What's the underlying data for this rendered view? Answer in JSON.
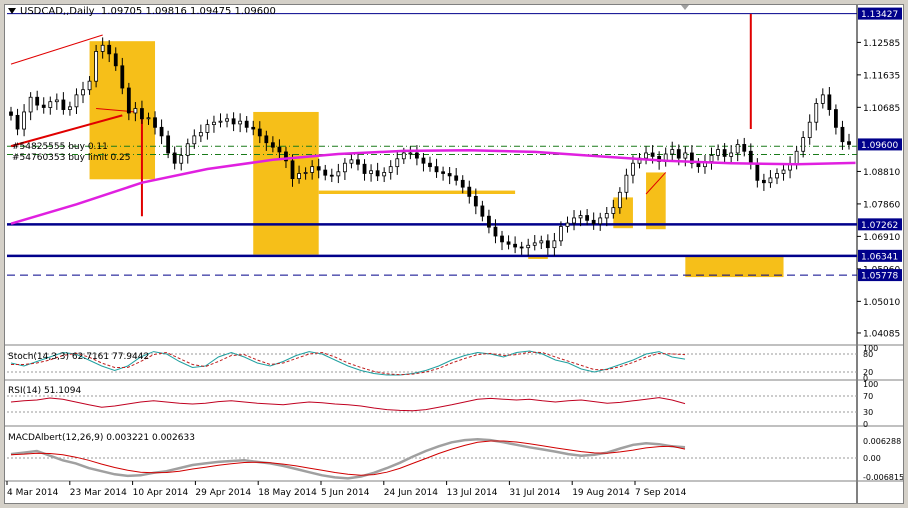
{
  "header": {
    "symbol": "USDCAD,,Daily",
    "ohlc": "1.09705 1.09816 1.09475 1.09600"
  },
  "orders": [
    "#54825555 buy 0.11",
    "#54760353 buy limit 0.25"
  ],
  "indicators": {
    "stoch": "Stoch(14,3,3) 62.7161 77.9442",
    "rsi": "RSI(14) 51.1094",
    "macd": "MACDAlbert(12,26,9) 0.003221 0.002633"
  },
  "colors": {
    "candle": "#000000",
    "ma": "#e020e0",
    "zone": "#f5b800",
    "blue_line": "#00008b",
    "red_line": "#e00000",
    "price_tag": "#00008b",
    "green_dash": "#1a7a1a"
  },
  "chart_data": {
    "type": "candlestick",
    "title": "USDCAD,,Daily",
    "y_ticks": [
      "1.12585",
      "1.11635",
      "1.10685",
      "1.08810",
      "1.07860",
      "1.06910",
      "1.05960",
      "1.05010",
      "1.04085"
    ],
    "y_tick_values": [
      1.12585,
      1.11635,
      1.10685,
      1.0881,
      1.0786,
      1.0691,
      1.0596,
      1.0501,
      1.04085
    ],
    "price_tags": [
      {
        "label": "1.13427",
        "value": 1.13427
      },
      {
        "label": "1.09600",
        "value": 1.096
      },
      {
        "label": "1.07262",
        "value": 1.07262
      },
      {
        "label": "1.06341",
        "value": 1.06341
      },
      {
        "label": "1.05778",
        "value": 1.05778
      }
    ],
    "x_labels": [
      "4 Mar 2014",
      "23 Mar 2014",
      "10 Apr 2014",
      "29 Apr 2014",
      "18 May 2014",
      "5 Jun 2014",
      "24 Jun 2014",
      "13 Jul 2014",
      "31 Jul 2014",
      "19 Aug 2014",
      "7 Sep 2014"
    ],
    "ylim": [
      1.0385,
      1.1362
    ],
    "closes": [
      1.1045,
      1.1005,
      1.1055,
      1.1098,
      1.1075,
      1.1068,
      1.1085,
      1.109,
      1.1062,
      1.107,
      1.1105,
      1.112,
      1.1145,
      1.1232,
      1.125,
      1.1225,
      1.119,
      1.1125,
      1.1052,
      1.1065,
      1.1035,
      1.1038,
      1.101,
      1.0985,
      1.0935,
      1.0905,
      1.0928,
      1.0962,
      1.0985,
      1.0995,
      1.1018,
      1.1025,
      1.1028,
      1.1035,
      1.102,
      1.1028,
      1.101,
      1.1005,
      1.0985,
      1.0965,
      1.0952,
      1.0938,
      1.0912,
      1.086,
      1.0875,
      1.0878,
      1.0895,
      1.0885,
      1.087,
      1.0868,
      1.088,
      1.0905,
      1.0915,
      1.0902,
      1.0875,
      1.0883,
      1.0868,
      1.0878,
      1.0895,
      1.0918,
      1.0935,
      1.0935,
      1.092,
      1.0905,
      1.0895,
      1.088,
      1.0875,
      1.0868,
      1.0855,
      1.0835,
      1.0808,
      1.078,
      1.075,
      1.0718,
      1.0692,
      1.0675,
      1.0668,
      1.066,
      1.0658,
      1.0665,
      1.0672,
      1.0678,
      1.0658,
      1.0678,
      1.072,
      1.073,
      1.0745,
      1.0752,
      1.0738,
      1.0728,
      1.0745,
      1.0758,
      1.0775,
      1.082,
      1.087,
      1.0905,
      1.092,
      1.0935,
      1.0925,
      1.091,
      1.0932,
      1.0945,
      1.092,
      1.0935,
      1.0905,
      1.0895,
      1.091,
      1.0928,
      1.0945,
      1.0925,
      1.0935,
      1.096,
      1.094,
      1.0905,
      1.0855,
      1.0848,
      1.0862,
      1.0875,
      1.0885,
      1.0902,
      1.094,
      1.098,
      1.1025,
      1.108,
      1.1105,
      1.1062,
      1.101,
      1.0968,
      1.096
    ],
    "ma": [
      [
        0,
        1.0728
      ],
      [
        10,
        1.0785
      ],
      [
        20,
        1.0848
      ],
      [
        30,
        1.0888
      ],
      [
        40,
        1.0915
      ],
      [
        50,
        1.0932
      ],
      [
        60,
        1.0941
      ],
      [
        70,
        1.0943
      ],
      [
        80,
        1.0938
      ],
      [
        90,
        1.0925
      ],
      [
        100,
        1.0912
      ],
      [
        110,
        1.0905
      ],
      [
        120,
        1.0902
      ],
      [
        129,
        1.0906
      ]
    ],
    "horizontal_lines": [
      {
        "value": 1.13427,
        "style": "solid",
        "color": "#00008b"
      },
      {
        "value": 1.09545,
        "style": "dashdot",
        "color": "#1a7a1a"
      },
      {
        "value": 1.09305,
        "style": "dashdot",
        "color": "#1a7a1a"
      },
      {
        "value": 1.07262,
        "style": "solid",
        "color": "#00008b"
      },
      {
        "value": 1.06341,
        "style": "solid",
        "color": "#00008b"
      },
      {
        "value": 1.05778,
        "style": "dashed",
        "color": "#00008b"
      }
    ],
    "zones": [
      {
        "i0": 12,
        "i1": 22,
        "v0": 1.1262,
        "v1": 1.0858
      },
      {
        "i0": 37,
        "i1": 47,
        "v0": 1.1055,
        "v1": 1.0638
      },
      {
        "i0": 103,
        "i1": 118,
        "v0": 1.0636,
        "v1": 1.0572
      },
      {
        "i0": 79,
        "i1": 82,
        "v0": 1.0635,
        "v1": 1.0625
      },
      {
        "i0": 47,
        "i1": 77,
        "v0": 1.0825,
        "v1": 1.0815
      },
      {
        "i0": 92,
        "i1": 95,
        "v0": 1.0805,
        "v1": 1.0715
      },
      {
        "i0": 97,
        "i1": 100,
        "v0": 1.0878,
        "v1": 1.0712
      }
    ],
    "stoch": {
      "label": "Stoch(14,3,3) 62.7161 77.9442",
      "ticks": [
        "100",
        "80",
        "20",
        "0"
      ],
      "main": [
        50,
        40,
        55,
        70,
        85,
        80,
        60,
        40,
        25,
        40,
        70,
        88,
        80,
        55,
        35,
        40,
        70,
        85,
        70,
        50,
        40,
        55,
        75,
        88,
        80,
        60,
        40,
        25,
        15,
        10,
        10,
        15,
        25,
        40,
        60,
        75,
        85,
        80,
        70,
        85,
        90,
        80,
        60,
        50,
        30,
        20,
        30,
        45,
        60,
        80,
        88,
        70,
        63
      ],
      "signal": [
        45,
        45,
        50,
        60,
        75,
        82,
        70,
        50,
        35,
        35,
        55,
        78,
        85,
        65,
        45,
        38,
        55,
        75,
        78,
        60,
        45,
        50,
        65,
        80,
        85,
        70,
        50,
        35,
        22,
        14,
        11,
        13,
        20,
        32,
        50,
        65,
        78,
        82,
        75,
        78,
        86,
        85,
        70,
        56,
        42,
        28,
        28,
        38,
        52,
        70,
        82,
        80,
        78
      ]
    },
    "rsi": {
      "label": "RSI(14) 51.1094",
      "ticks": [
        "100",
        "70",
        "30",
        "0"
      ],
      "values": [
        55,
        58,
        60,
        65,
        62,
        55,
        48,
        42,
        45,
        50,
        55,
        58,
        55,
        52,
        50,
        52,
        56,
        58,
        55,
        52,
        50,
        48,
        52,
        55,
        53,
        50,
        48,
        45,
        40,
        36,
        34,
        33,
        36,
        42,
        48,
        55,
        62,
        64,
        62,
        60,
        62,
        58,
        55,
        58,
        60,
        56,
        52,
        54,
        58,
        62,
        66,
        60,
        51
      ]
    },
    "macd": {
      "label": "MACDAlbert(12,26,9) 0.003221 0.002633",
      "ticks": [
        "0.006288",
        "0.00",
        "-0.006815"
      ],
      "main": [
        0.001,
        0.0015,
        0.002,
        0.0005,
        -0.001,
        -0.002,
        -0.0035,
        -0.0045,
        -0.0055,
        -0.006,
        -0.0058,
        -0.005,
        -0.0045,
        -0.0035,
        -0.0025,
        -0.002,
        -0.0015,
        -0.0012,
        -0.001,
        -0.0015,
        -0.002,
        -0.0028,
        -0.0038,
        -0.0048,
        -0.0058,
        -0.0065,
        -0.0068,
        -0.0062,
        -0.005,
        -0.0035,
        -0.0018,
        0.0002,
        0.002,
        0.0035,
        0.0048,
        0.0055,
        0.0058,
        0.0055,
        0.0048,
        0.004,
        0.0032,
        0.0025,
        0.0018,
        0.001,
        0.0005,
        0.0008,
        0.0015,
        0.0028,
        0.004,
        0.0045,
        0.0042,
        0.0035,
        0.0032
      ],
      "signal": [
        0.0008,
        0.001,
        0.0013,
        0.0012,
        0.0008,
        0.0,
        -0.001,
        -0.0022,
        -0.0033,
        -0.0042,
        -0.0048,
        -0.005,
        -0.0049,
        -0.0045,
        -0.0038,
        -0.0032,
        -0.0026,
        -0.0021,
        -0.0017,
        -0.0016,
        -0.0018,
        -0.0022,
        -0.0028,
        -0.0035,
        -0.0042,
        -0.0049,
        -0.0055,
        -0.0058,
        -0.0056,
        -0.0048,
        -0.0036,
        -0.002,
        -0.0004,
        0.0012,
        0.0026,
        0.0038,
        0.0048,
        0.0052,
        0.0052,
        0.0049,
        0.0043,
        0.0037,
        0.003,
        0.0024,
        0.0018,
        0.0014,
        0.0013,
        0.0017,
        0.0023,
        0.003,
        0.0034,
        0.0035,
        0.0026
      ]
    }
  }
}
